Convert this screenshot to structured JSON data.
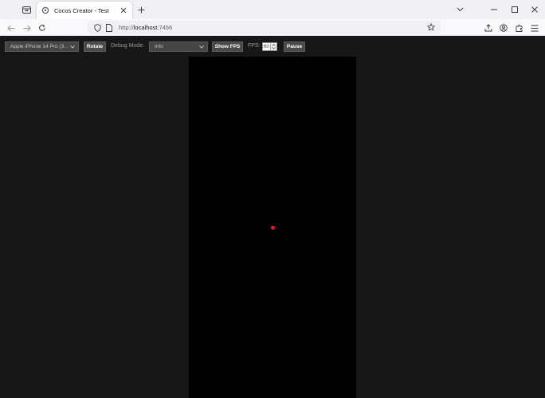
{
  "browser": {
    "tab": {
      "title": "Cocos Creator - Test"
    },
    "address": {
      "scheme": "http://",
      "host": "localhost",
      "port": ":7456"
    }
  },
  "preview_toolbar": {
    "device_select": {
      "value": "Apple iPhone 14 Pro (3..."
    },
    "rotate_label": "Rotate",
    "debug_mode": {
      "label": "Debug Mode:",
      "value": "Info"
    },
    "show_fps_label": "Show FPS",
    "fps": {
      "label": "FPS:",
      "value": "60"
    },
    "pause_label": "Pause"
  },
  "colors": {
    "page_bg": "#171717",
    "canvas_bg": "#000000",
    "dot": "#d81e2a"
  }
}
